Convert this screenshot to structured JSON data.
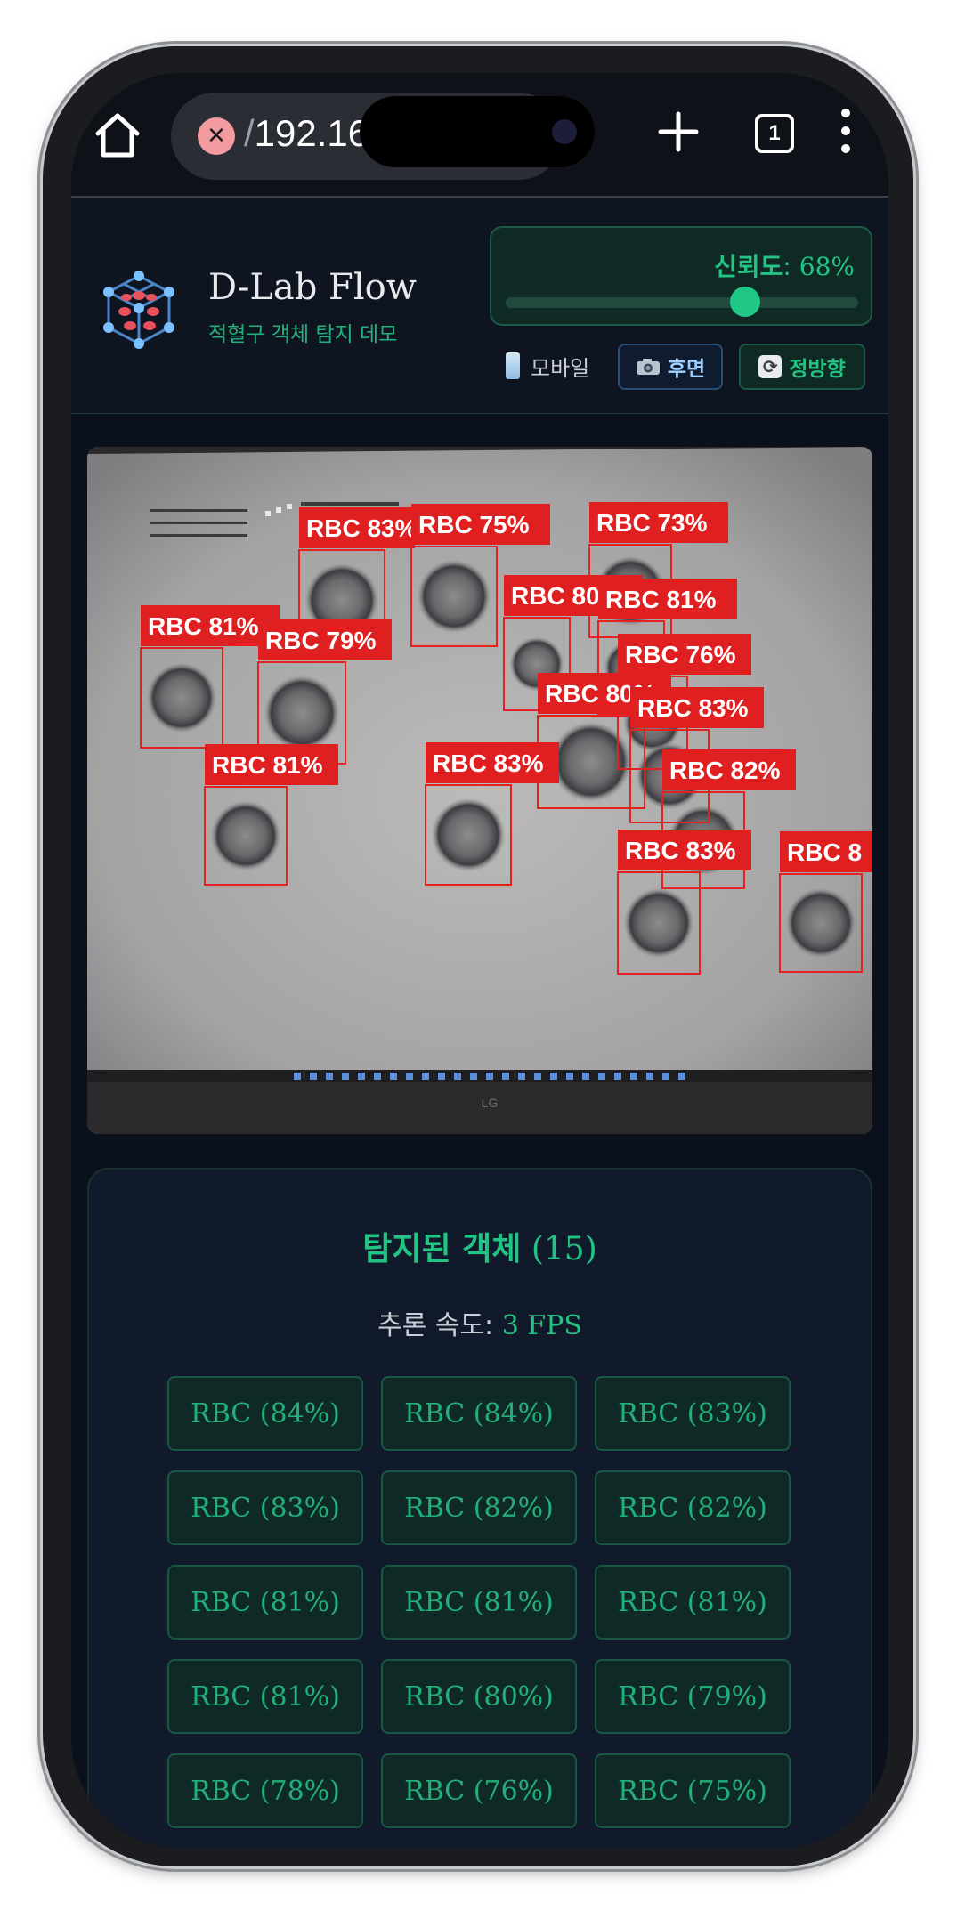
{
  "browser": {
    "url_prefix": "/",
    "url_text": "192.168",
    "tab_count": "1"
  },
  "app": {
    "title": "D-Lab Flow",
    "subtitle": "적혈구 객체 탐지 데모",
    "confidence_label": "신뢰도",
    "confidence_value": "68%",
    "confidence_fraction": 0.68,
    "mode_label": "모바일",
    "rear_button": "후면",
    "front_button": "정방향"
  },
  "detections": {
    "boxes": [
      {
        "label": "RBC 83%"
      },
      {
        "label": "RBC 75%"
      },
      {
        "label": "RBC 73%"
      },
      {
        "label": "RBC 81%"
      },
      {
        "label": "RBC 80%"
      },
      {
        "label": "RBC 81%"
      },
      {
        "label": "RBC 79%"
      },
      {
        "label": "RBC 76%"
      },
      {
        "label": "RBC 80%"
      },
      {
        "label": "RBC 83%"
      },
      {
        "label": "RBC 81%"
      },
      {
        "label": "RBC 83%"
      },
      {
        "label": "RBC 82%"
      },
      {
        "label": "RBC 83%"
      },
      {
        "label": "RBC 8"
      }
    ],
    "colors": {
      "box": "#e52222",
      "label_bg": "#e02020",
      "accent": "#23c483"
    }
  },
  "results": {
    "title_label": "탐지된 객체",
    "title_count": "(15)",
    "speed_label": "추론 속도:",
    "speed_value": "3 FPS",
    "chips": [
      "RBC (84%)",
      "RBC (84%)",
      "RBC (83%)",
      "RBC (83%)",
      "RBC (82%)",
      "RBC (82%)",
      "RBC (81%)",
      "RBC (81%)",
      "RBC (81%)",
      "RBC (81%)",
      "RBC (80%)",
      "RBC (79%)",
      "RBC (78%)",
      "RBC (76%)",
      "RBC (75%)"
    ]
  }
}
